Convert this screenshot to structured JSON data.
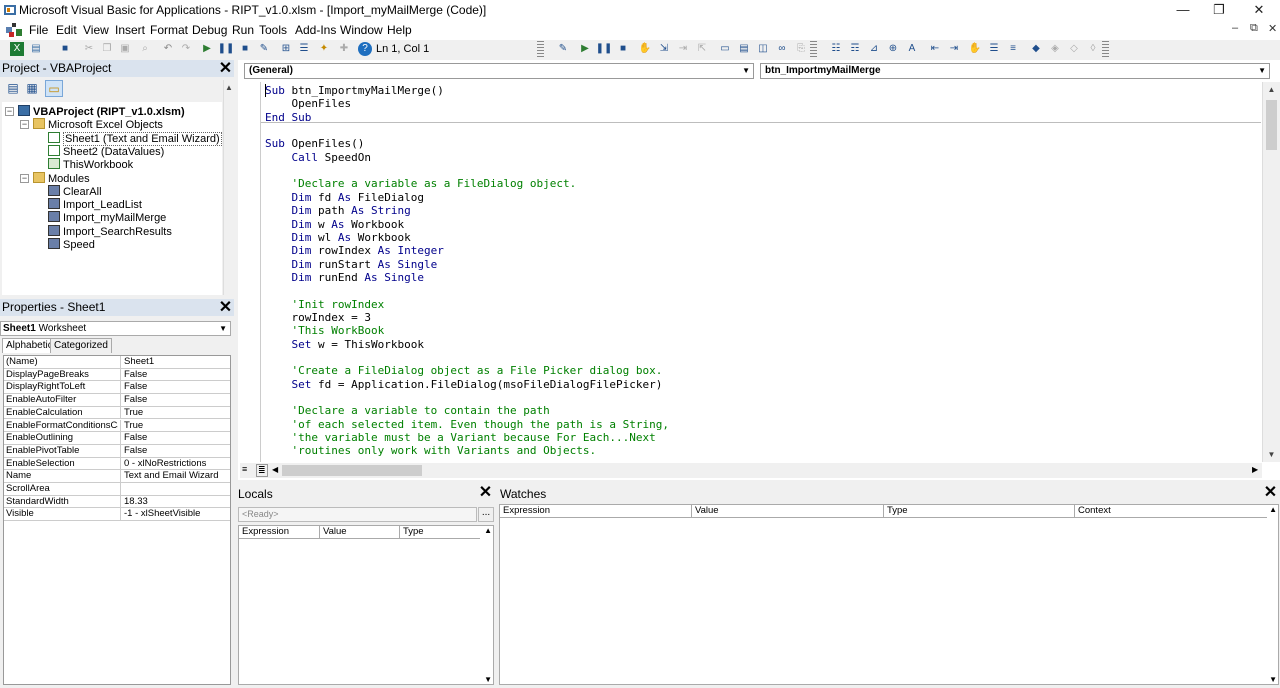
{
  "window": {
    "title": "Microsoft Visual Basic for Applications - RIPT_v1.0.xlsm - [Import_myMailMerge (Code)]",
    "minimize": "—",
    "maximize": "❐",
    "close": "✕"
  },
  "menubar": {
    "items": [
      "File",
      "Edit",
      "View",
      "Insert",
      "Format",
      "Debug",
      "Run",
      "Tools",
      "Add-Ins",
      "Window",
      "Help"
    ],
    "doc_minimize": "–",
    "doc_restore": "⧉",
    "doc_close": "✕"
  },
  "toolbar": {
    "position": "Ln 1, Col 1"
  },
  "project": {
    "title": "Project - VBAProject",
    "tree": [
      {
        "label": "VBAProject (RIPT_v1.0.xlsm)",
        "level": 0,
        "icon": "vbaproject-icon",
        "bold": true
      },
      {
        "label": "Microsoft Excel Objects",
        "level": 1,
        "icon": "folder-icon"
      },
      {
        "label": "Sheet1 (Text and Email Wizard)",
        "level": 2,
        "icon": "sheet-icon",
        "selected": true
      },
      {
        "label": "Sheet2 (DataValues)",
        "level": 2,
        "icon": "sheet-icon"
      },
      {
        "label": "ThisWorkbook",
        "level": 2,
        "icon": "workbook-icon"
      },
      {
        "label": "Modules",
        "level": 1,
        "icon": "folder-icon"
      },
      {
        "label": "ClearAll",
        "level": 2,
        "icon": "module-icon"
      },
      {
        "label": "Import_LeadList",
        "level": 2,
        "icon": "module-icon"
      },
      {
        "label": "Import_myMailMerge",
        "level": 2,
        "icon": "module-icon"
      },
      {
        "label": "Import_SearchResults",
        "level": 2,
        "icon": "module-icon"
      },
      {
        "label": "Speed",
        "level": 2,
        "icon": "module-icon"
      }
    ]
  },
  "properties": {
    "title": "Properties - Sheet1",
    "object_name": "Sheet1",
    "object_type": "Worksheet",
    "tabs": [
      "Alphabetic",
      "Categorized"
    ],
    "rows": [
      {
        "name": "(Name)",
        "value": "Sheet1"
      },
      {
        "name": "DisplayPageBreaks",
        "value": "False"
      },
      {
        "name": "DisplayRightToLeft",
        "value": "False"
      },
      {
        "name": "EnableAutoFilter",
        "value": "False"
      },
      {
        "name": "EnableCalculation",
        "value": "True"
      },
      {
        "name": "EnableFormatConditionsCalcu",
        "value": "True"
      },
      {
        "name": "EnableOutlining",
        "value": "False"
      },
      {
        "name": "EnablePivotTable",
        "value": "False"
      },
      {
        "name": "EnableSelection",
        "value": "0 - xlNoRestrictions"
      },
      {
        "name": "Name",
        "value": "Text and Email Wizard"
      },
      {
        "name": "ScrollArea",
        "value": ""
      },
      {
        "name": "StandardWidth",
        "value": "18.33"
      },
      {
        "name": "Visible",
        "value": "-1 - xlSheetVisible"
      }
    ]
  },
  "code": {
    "object_combo": "(General)",
    "proc_combo": "btn_ImportmyMailMerge",
    "lines": [
      [
        {
          "t": "Sub",
          "c": "kw"
        },
        {
          "t": " btn_ImportmyMailMerge()"
        }
      ],
      [
        {
          "t": "    OpenFiles"
        }
      ],
      [
        {
          "t": "End Sub",
          "c": "kw"
        }
      ],
      [],
      [
        {
          "t": "Sub",
          "c": "kw"
        },
        {
          "t": " OpenFiles()"
        }
      ],
      [
        {
          "t": "    "
        },
        {
          "t": "Call",
          "c": "kw"
        },
        {
          "t": " SpeedOn"
        }
      ],
      [],
      [
        {
          "t": "    'Declare a variable as a FileDialog object.",
          "c": "cm"
        }
      ],
      [
        {
          "t": "    "
        },
        {
          "t": "Dim",
          "c": "kw"
        },
        {
          "t": " fd "
        },
        {
          "t": "As",
          "c": "kw"
        },
        {
          "t": " FileDialog"
        }
      ],
      [
        {
          "t": "    "
        },
        {
          "t": "Dim",
          "c": "kw"
        },
        {
          "t": " path "
        },
        {
          "t": "As",
          "c": "kw"
        },
        {
          "t": " "
        },
        {
          "t": "String",
          "c": "kw"
        }
      ],
      [
        {
          "t": "    "
        },
        {
          "t": "Dim",
          "c": "kw"
        },
        {
          "t": " w "
        },
        {
          "t": "As",
          "c": "kw"
        },
        {
          "t": " Workbook"
        }
      ],
      [
        {
          "t": "    "
        },
        {
          "t": "Dim",
          "c": "kw"
        },
        {
          "t": " wl "
        },
        {
          "t": "As",
          "c": "kw"
        },
        {
          "t": " Workbook"
        }
      ],
      [
        {
          "t": "    "
        },
        {
          "t": "Dim",
          "c": "kw"
        },
        {
          "t": " rowIndex "
        },
        {
          "t": "As",
          "c": "kw"
        },
        {
          "t": " "
        },
        {
          "t": "Integer",
          "c": "kw"
        }
      ],
      [
        {
          "t": "    "
        },
        {
          "t": "Dim",
          "c": "kw"
        },
        {
          "t": " runStart "
        },
        {
          "t": "As",
          "c": "kw"
        },
        {
          "t": " "
        },
        {
          "t": "Single",
          "c": "kw"
        }
      ],
      [
        {
          "t": "    "
        },
        {
          "t": "Dim",
          "c": "kw"
        },
        {
          "t": " runEnd "
        },
        {
          "t": "As",
          "c": "kw"
        },
        {
          "t": " "
        },
        {
          "t": "Single",
          "c": "kw"
        }
      ],
      [],
      [
        {
          "t": "    'Init rowIndex",
          "c": "cm"
        }
      ],
      [
        {
          "t": "    rowIndex = 3"
        }
      ],
      [
        {
          "t": "    'This WorkBook",
          "c": "cm"
        }
      ],
      [
        {
          "t": "    "
        },
        {
          "t": "Set",
          "c": "kw"
        },
        {
          "t": " w = ThisWorkbook"
        }
      ],
      [],
      [
        {
          "t": "    'Create a FileDialog object as a File Picker dialog box.",
          "c": "cm"
        }
      ],
      [
        {
          "t": "    "
        },
        {
          "t": "Set",
          "c": "kw"
        },
        {
          "t": " fd = Application.FileDialog(msoFileDialogFilePicker)"
        }
      ],
      [],
      [
        {
          "t": "    'Declare a variable to contain the path",
          "c": "cm"
        }
      ],
      [
        {
          "t": "    'of each selected item. Even though the path is a String,",
          "c": "cm"
        }
      ],
      [
        {
          "t": "    'the variable must be a Variant because For Each...Next",
          "c": "cm"
        }
      ],
      [
        {
          "t": "    'routines only work with Variants and Objects.",
          "c": "cm"
        }
      ]
    ]
  },
  "locals": {
    "title": "Locals",
    "status": "<Ready>",
    "button": "...",
    "columns": [
      "Expression",
      "Value",
      "Type"
    ]
  },
  "watches": {
    "title": "Watches",
    "columns": [
      "Expression",
      "Value",
      "Type",
      "Context"
    ]
  },
  "colors": {
    "keyword": "#00008b",
    "comment": "#008000",
    "panel_header": "#dae3ee"
  }
}
